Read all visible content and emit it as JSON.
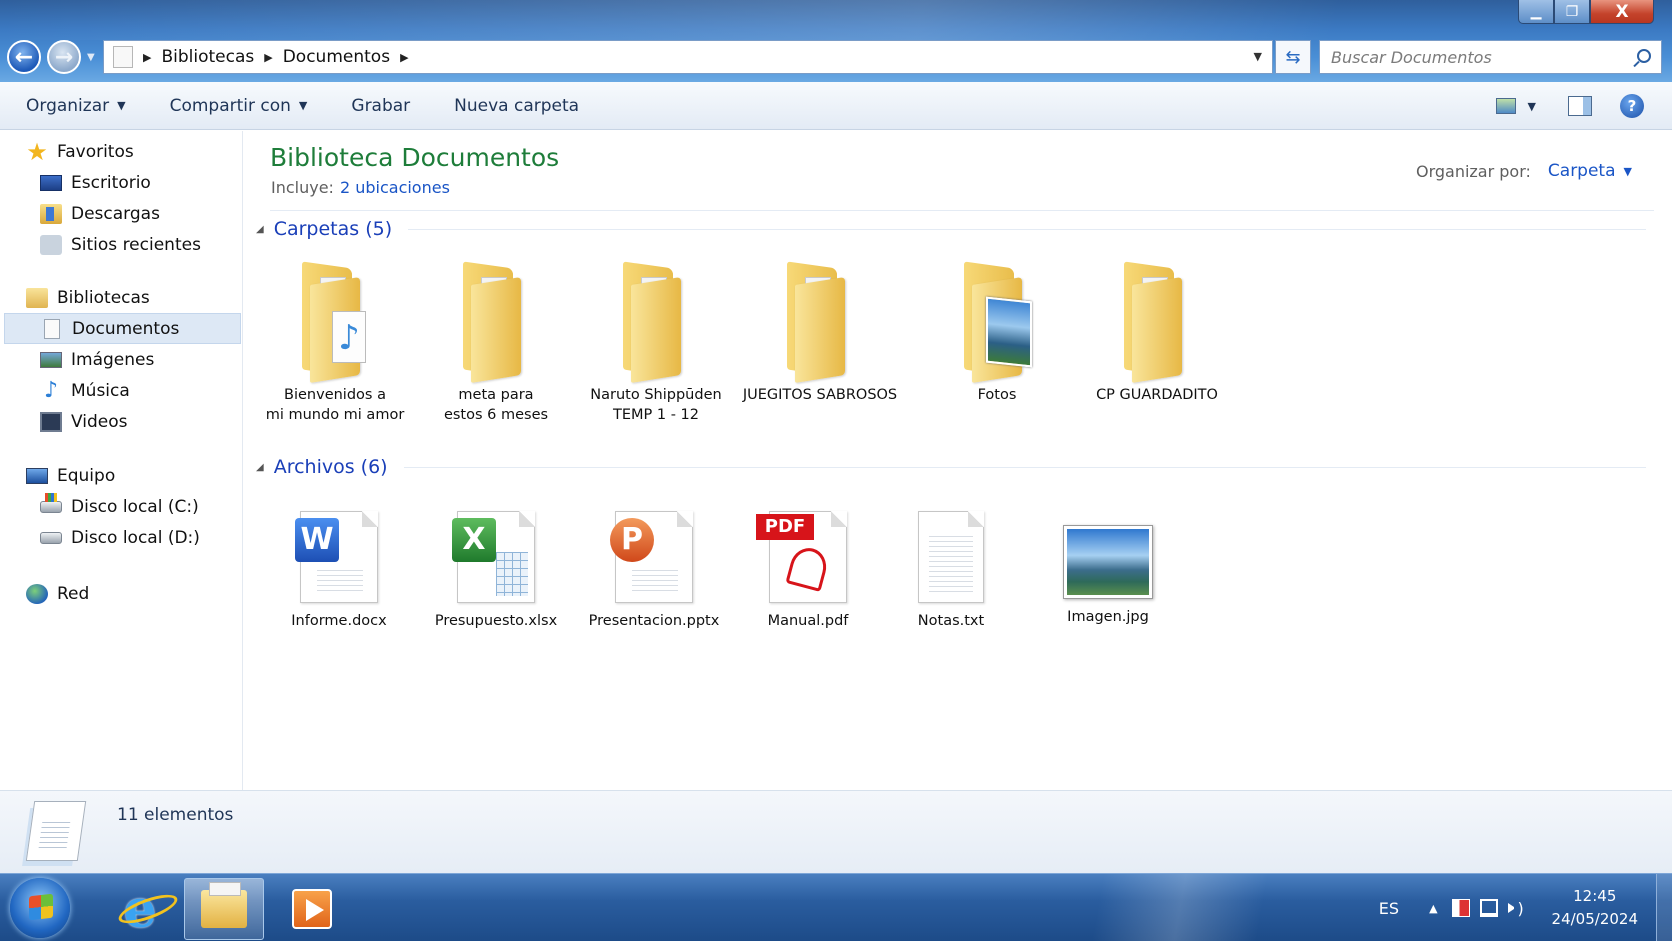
{
  "window": {
    "controls": {
      "minimize": "▁",
      "maximize": "❐",
      "close": "X"
    }
  },
  "address": {
    "breadcrumbs": [
      "Bibliotecas",
      "Documentos"
    ],
    "search_placeholder": "Buscar Documentos"
  },
  "toolbar": {
    "organize": "Organizar",
    "share": "Compartir con",
    "burn": "Grabar",
    "new_folder": "Nueva carpeta"
  },
  "sidebar": {
    "favorites": {
      "label": "Favoritos",
      "items": [
        {
          "label": "Escritorio",
          "icon": "desktop-icon"
        },
        {
          "label": "Descargas",
          "icon": "downloads-icon"
        },
        {
          "label": "Sitios recientes",
          "icon": "recent-places-icon"
        }
      ]
    },
    "libraries": {
      "label": "Bibliotecas",
      "items": [
        {
          "label": "Documentos",
          "icon": "documents-icon",
          "selected": true
        },
        {
          "label": "Imágenes",
          "icon": "pictures-icon"
        },
        {
          "label": "Música",
          "icon": "music-icon"
        },
        {
          "label": "Videos",
          "icon": "videos-icon"
        }
      ]
    },
    "computer": {
      "label": "Equipo",
      "items": [
        {
          "label": "Disco local (C:)",
          "icon": "system-drive-icon"
        },
        {
          "label": "Disco local (D:)",
          "icon": "drive-icon"
        }
      ]
    },
    "network": {
      "label": "Red"
    }
  },
  "main": {
    "title": "Biblioteca Documentos",
    "includes_label": "Incluye:",
    "includes_link": "2 ubicaciones",
    "arrange_label": "Organizar por:",
    "arrange_value": "Carpeta",
    "folders_group": "Carpetas (5)",
    "files_group": "Archivos (6)",
    "folders": [
      {
        "line1": "Bienvenidos a",
        "line2": "mi mundo mi amor",
        "icon": "music-folder-icon"
      },
      {
        "line1": "meta para",
        "line2": "estos 6 meses",
        "icon": "folder-icon"
      },
      {
        "line1": "Naruto Shippūden",
        "line2": "TEMP 1 - 12",
        "icon": "folder-icon"
      },
      {
        "line1": "JUEGITOS SABROSOS",
        "line2": "",
        "icon": "folder-icon"
      },
      {
        "line1": "Fotos",
        "line2": "",
        "icon": "photo-folder-icon"
      },
      {
        "line1": "CP GUARDADITO",
        "line2": "",
        "icon": "folder-icon"
      }
    ],
    "files": [
      {
        "name": "Informe.docx",
        "icon": "word-file-icon",
        "badge": "W"
      },
      {
        "name": "Presupuesto.xlsx",
        "icon": "excel-file-icon",
        "badge": "X"
      },
      {
        "name": "Presentacion.pptx",
        "icon": "powerpoint-file-icon",
        "badge": "P"
      },
      {
        "name": "Manual.pdf",
        "icon": "pdf-file-icon",
        "badge": "PDF"
      },
      {
        "name": "Notas.txt",
        "icon": "text-file-icon"
      },
      {
        "name": "Imagen.jpg",
        "icon": "image-file-icon"
      }
    ]
  },
  "details": {
    "count": "11 elementos"
  },
  "taskbar": {
    "language": "ES",
    "time": "12:45",
    "date": "24/05/2024"
  }
}
